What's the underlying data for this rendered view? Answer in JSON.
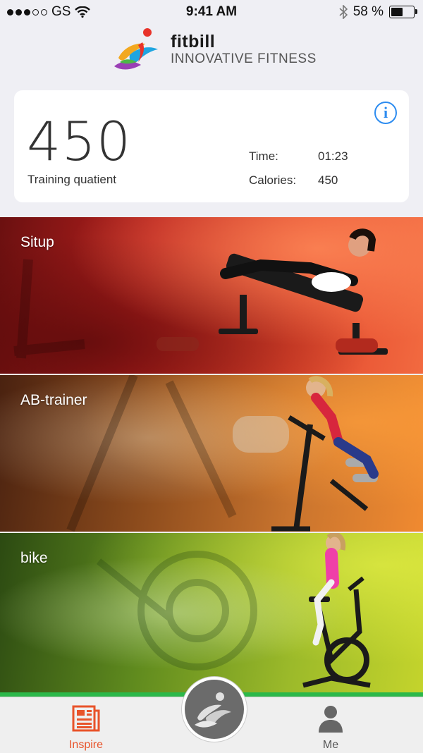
{
  "status_bar": {
    "carrier": "GS",
    "time": "9:41 AM",
    "battery": "58 %",
    "battery_level": 0.58
  },
  "header": {
    "brand": "fitbill",
    "tagline": "INNOVATIVE FITNESS"
  },
  "stats": {
    "training_quotient": "450",
    "training_quotient_label": "Training quatient",
    "time_label": "Time:",
    "time_value": "01:23",
    "calories_label": "Calories:",
    "calories_value": "450",
    "info_icon": "info-icon"
  },
  "exercises": [
    {
      "label": "Situp",
      "color": "#c8261f"
    },
    {
      "label": "AB-trainer",
      "color": "#c46a28"
    },
    {
      "label": "bike",
      "color": "#7aa020"
    }
  ],
  "tab_bar": {
    "items": [
      {
        "label": "Inspire",
        "icon": "newspaper-icon",
        "active": true,
        "color": "#e8532a"
      },
      {
        "label": "Me",
        "icon": "person-icon",
        "active": false,
        "color": "#555555"
      }
    ],
    "center_icon": "runner-logo-icon"
  }
}
